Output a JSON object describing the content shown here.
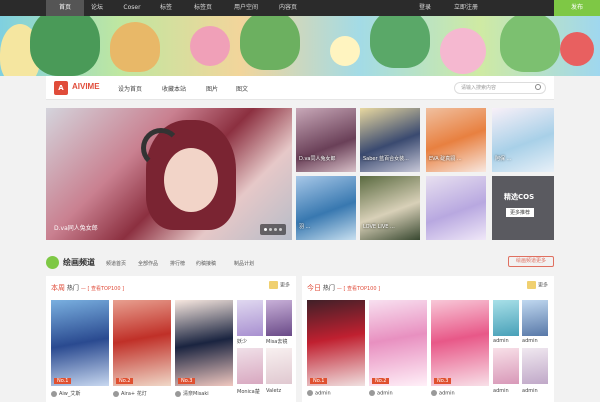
{
  "topnav": {
    "items": [
      "首页",
      "论坛",
      "Coser",
      "标签",
      "标签页",
      "用户空间",
      "内容页"
    ],
    "login": "登录",
    "register": "立即注册",
    "publish": "发布"
  },
  "logo": {
    "mark": "A",
    "text": "AIVIME"
  },
  "mainnav": [
    "设为首页",
    "收藏本站",
    "图片",
    "图文"
  ],
  "search": {
    "placeholder": "请输入搜索内容"
  },
  "gallery": {
    "big_caption": "D.va同人兔女郎",
    "thumbs": [
      "D.va同人兔女郎",
      "Saber 蓝百合女装...",
      "EVA 碇真嗣 ...",
      "阿保 ...",
      "",
      "羽 ...",
      "LOVE LIVE ...",
      "",
      "精选COS"
    ],
    "cos_title": "精选COS",
    "cos_button": "更多推荐"
  },
  "channel": {
    "title": "绘画频道",
    "links": [
      "频道首页",
      "全部作品",
      "排行榜",
      "约稿接稿",
      "制品计划"
    ],
    "more": "绘画频道更多"
  },
  "week_panel": {
    "head_a": "本周",
    "head_b": "热门",
    "head_c": "— [ 查看TOP100 ]",
    "more": "更多",
    "cards": [
      {
        "badge": "No.1",
        "user": "Aiw_艾斯"
      },
      {
        "badge": "No.2",
        "user": "Aira+ 花灯"
      },
      {
        "badge": "No.3",
        "user": "清奈Misaki"
      }
    ],
    "small": [
      {
        "user": "妖少"
      },
      {
        "user": "Misa去镜"
      },
      {
        "user": "Monica楚"
      },
      {
        "user": "Valetz"
      }
    ]
  },
  "today_panel": {
    "head_a": "今日",
    "head_b": "热门",
    "head_c": "— [ 查看TOP100 ]",
    "more": "更多",
    "cards": [
      {
        "badge": "No.1",
        "user": "admin"
      },
      {
        "badge": "No.2",
        "user": "admin"
      },
      {
        "badge": "No.3",
        "user": "admin"
      }
    ],
    "small": [
      {
        "user": "admin"
      },
      {
        "user": "admin"
      },
      {
        "user": "admin"
      },
      {
        "user": "admin"
      }
    ]
  },
  "colors": {
    "accent": "#e04c3a",
    "green": "#7ec845",
    "topbar": "#2b2b2b"
  }
}
